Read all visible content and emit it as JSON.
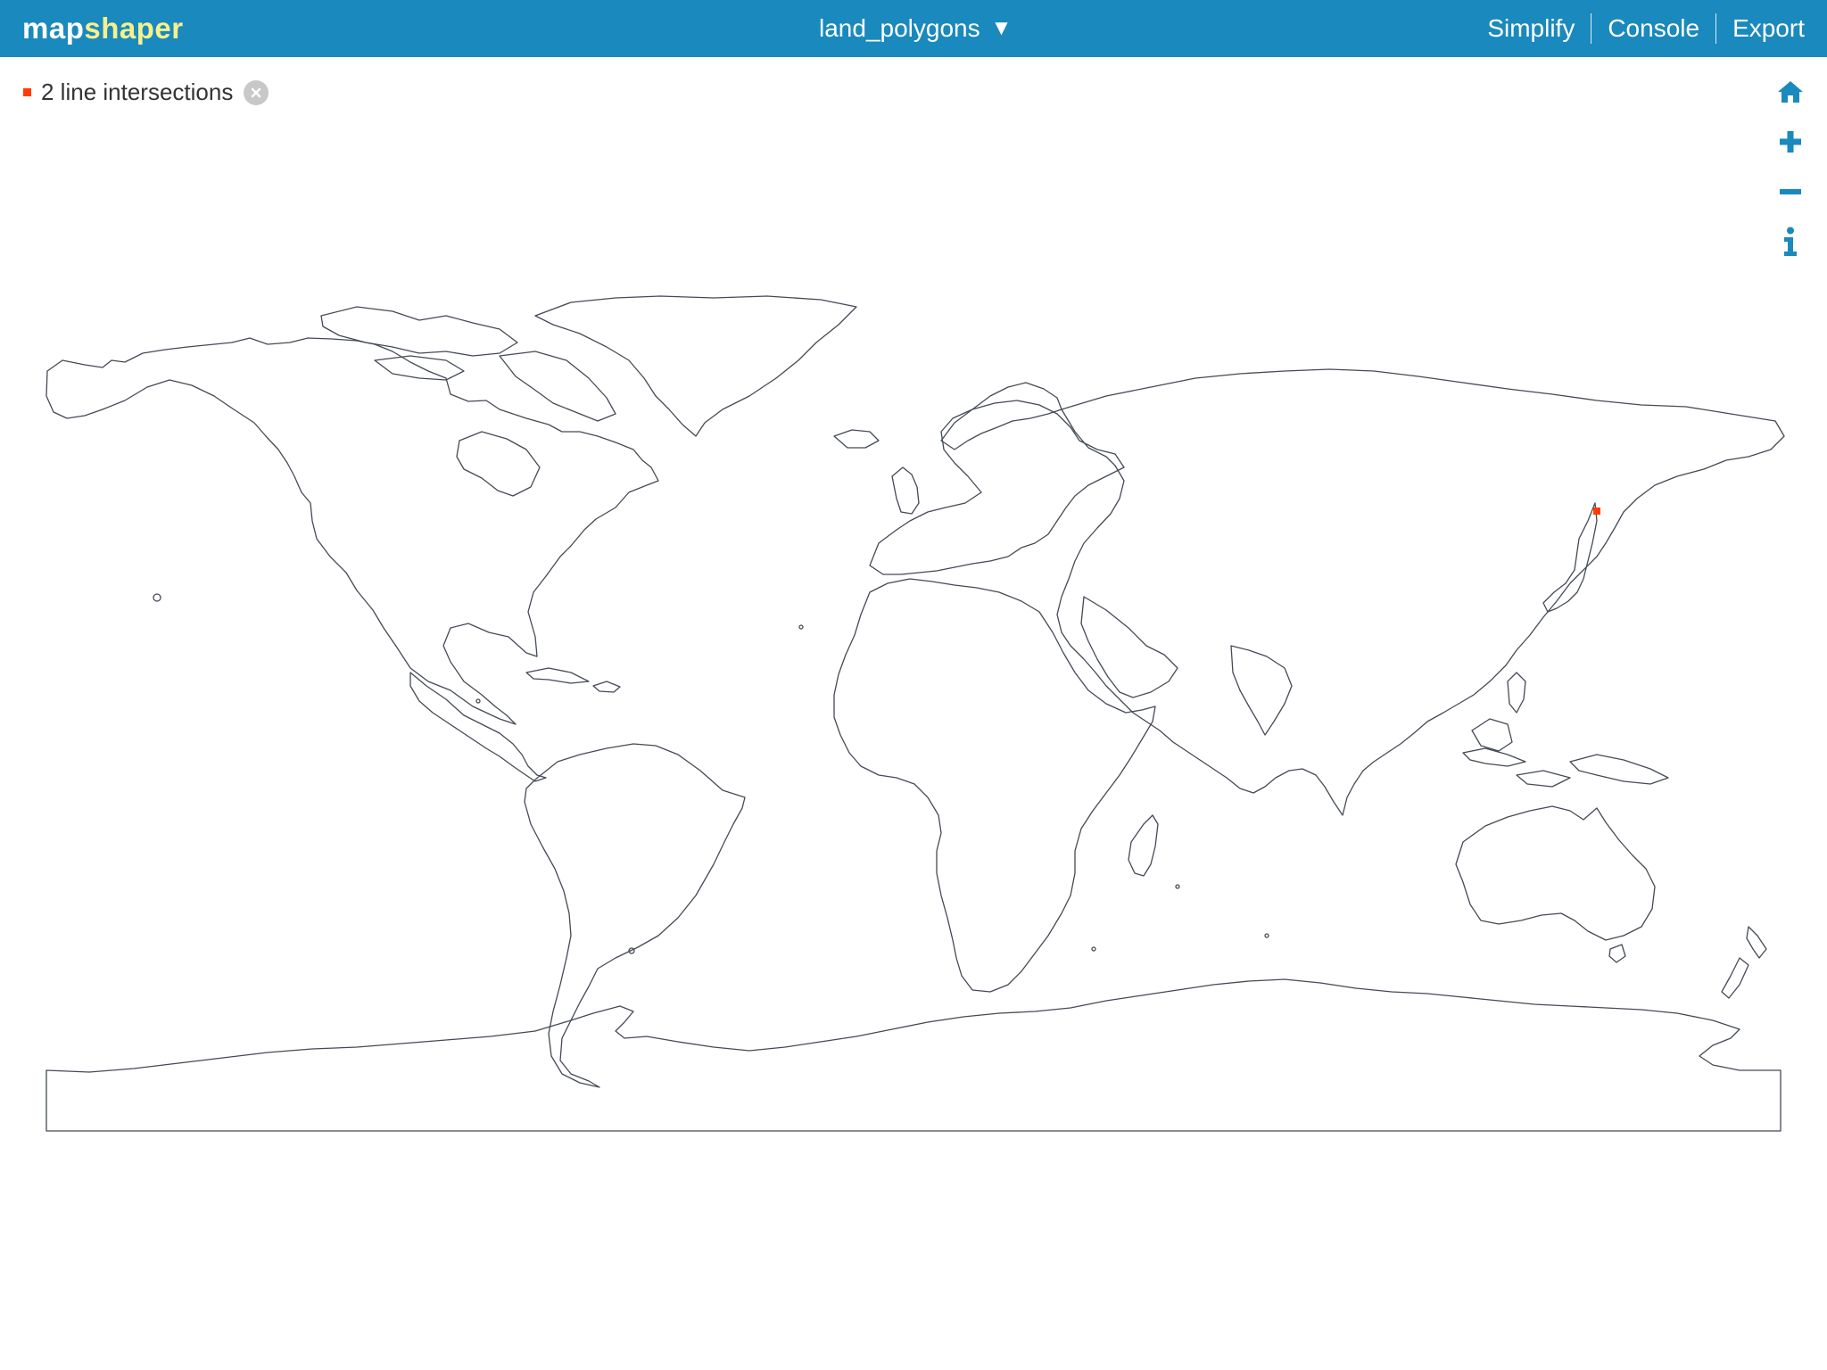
{
  "app": {
    "logo_part1": "map",
    "logo_part2": "shaper",
    "accent_color": "#1a89bd",
    "logo_highlight_color": "#f7f08c"
  },
  "layer_menu": {
    "label": "land_polygons",
    "caret": "▼"
  },
  "nav": {
    "simplify": "Simplify",
    "console": "Console",
    "export": "Export"
  },
  "intersections": {
    "label": "2 line intersections",
    "marker_color": "#ff3c00",
    "close_icon": "close-circle-icon"
  },
  "map_tools": [
    {
      "name": "home",
      "icon": "home-icon"
    },
    {
      "name": "zoom-in",
      "icon": "plus-icon"
    },
    {
      "name": "zoom-out",
      "icon": "minus-icon"
    },
    {
      "name": "info",
      "icon": "info-icon"
    }
  ],
  "map": {
    "layer": "land_polygons",
    "stroke_color": "#444a55",
    "intersection_color": "#ff3c00"
  }
}
